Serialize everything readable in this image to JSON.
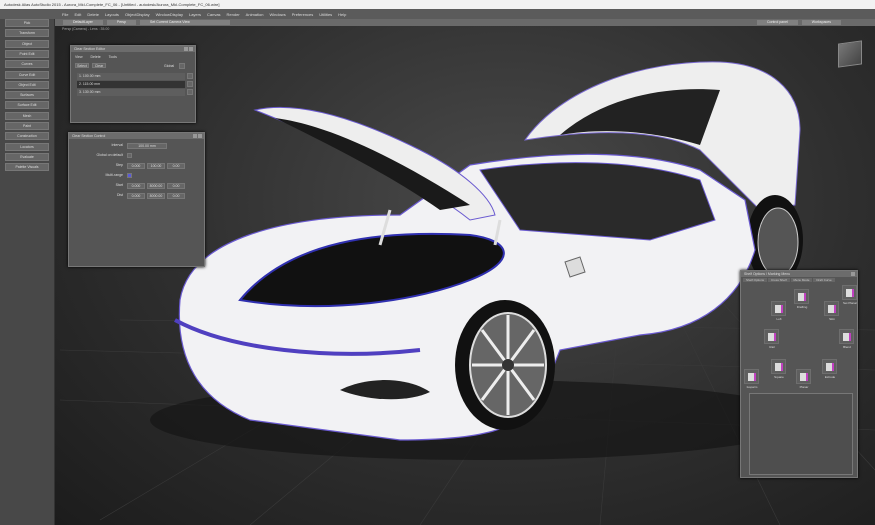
{
  "window": {
    "title": "Autodesk Alias AutoStudio 2015    -  Aurora_MkI-Complete_FC_06 - [Untitled - autodesk/Aurora_MkI-Complete_FC_06.wire]"
  },
  "menu": [
    "File",
    "Edit",
    "Delete",
    "Layouts",
    "ObjectDisplay",
    "WindowDisplay",
    "Layers",
    "Canvas",
    "Render",
    "Animation",
    "Windows",
    "Preferences",
    "Utilities",
    "Help"
  ],
  "toolbar": {
    "layer": "DefaultLayer",
    "view": "Persp",
    "status": "Set Current Camera View",
    "right_buttons": [
      "Control panel",
      "Workspaces"
    ]
  },
  "viewport": {
    "label": "Persp (Camera) - Lens : 35.00"
  },
  "palette": {
    "items": [
      "Pick",
      "Transform",
      "Object",
      "Point Edit",
      "Curves",
      "Curve Edit",
      "Object Edit",
      "Surfaces",
      "Surface Edit",
      "Mesh",
      "Paint",
      "Construction",
      "Locators",
      "Evaluate",
      "Palette Visuals"
    ]
  },
  "layer_dialog": {
    "title": "Clear Section Editor",
    "menu": [
      "View",
      "Delete",
      "Tools"
    ],
    "buttons": [
      "Select",
      "Clear"
    ],
    "toggle_label": "Global",
    "rows": [
      "1. 100.00 mm",
      "2. 115.00 mm",
      "3. 130.00 mm"
    ],
    "selected": 1
  },
  "section_dialog": {
    "title": "Clear Section Control",
    "fields": [
      {
        "label": "Interval",
        "values": [
          "100.00 mm"
        ]
      },
      {
        "label": "Global on default",
        "values": []
      },
      {
        "label": "Step",
        "values": [
          "0.000",
          "100.00",
          "0.00"
        ]
      },
      {
        "label": "Multi-range",
        "values": []
      },
      {
        "label": "Start",
        "values": [
          "0.000",
          "8000.00",
          "0.00"
        ]
      },
      {
        "label": "Dist",
        "values": [
          "0.000",
          "8000.00",
          "0.00"
        ]
      }
    ]
  },
  "shelf_dialog": {
    "title": "Shelf Options / Marking Menu",
    "tabs": [
      "Shelf Options",
      "Cross Shelf",
      "Menu Mode",
      "Draft Curve"
    ],
    "items": [
      "Drafting",
      "Loft",
      "Skin",
      "Blend",
      "Rail",
      "Square",
      "Extrude",
      "Planar",
      "Set Planar",
      "Isoparm"
    ]
  },
  "colors": {
    "accent": "#5a5ad8",
    "highlight": "#c040c0",
    "panel": "#555555"
  }
}
